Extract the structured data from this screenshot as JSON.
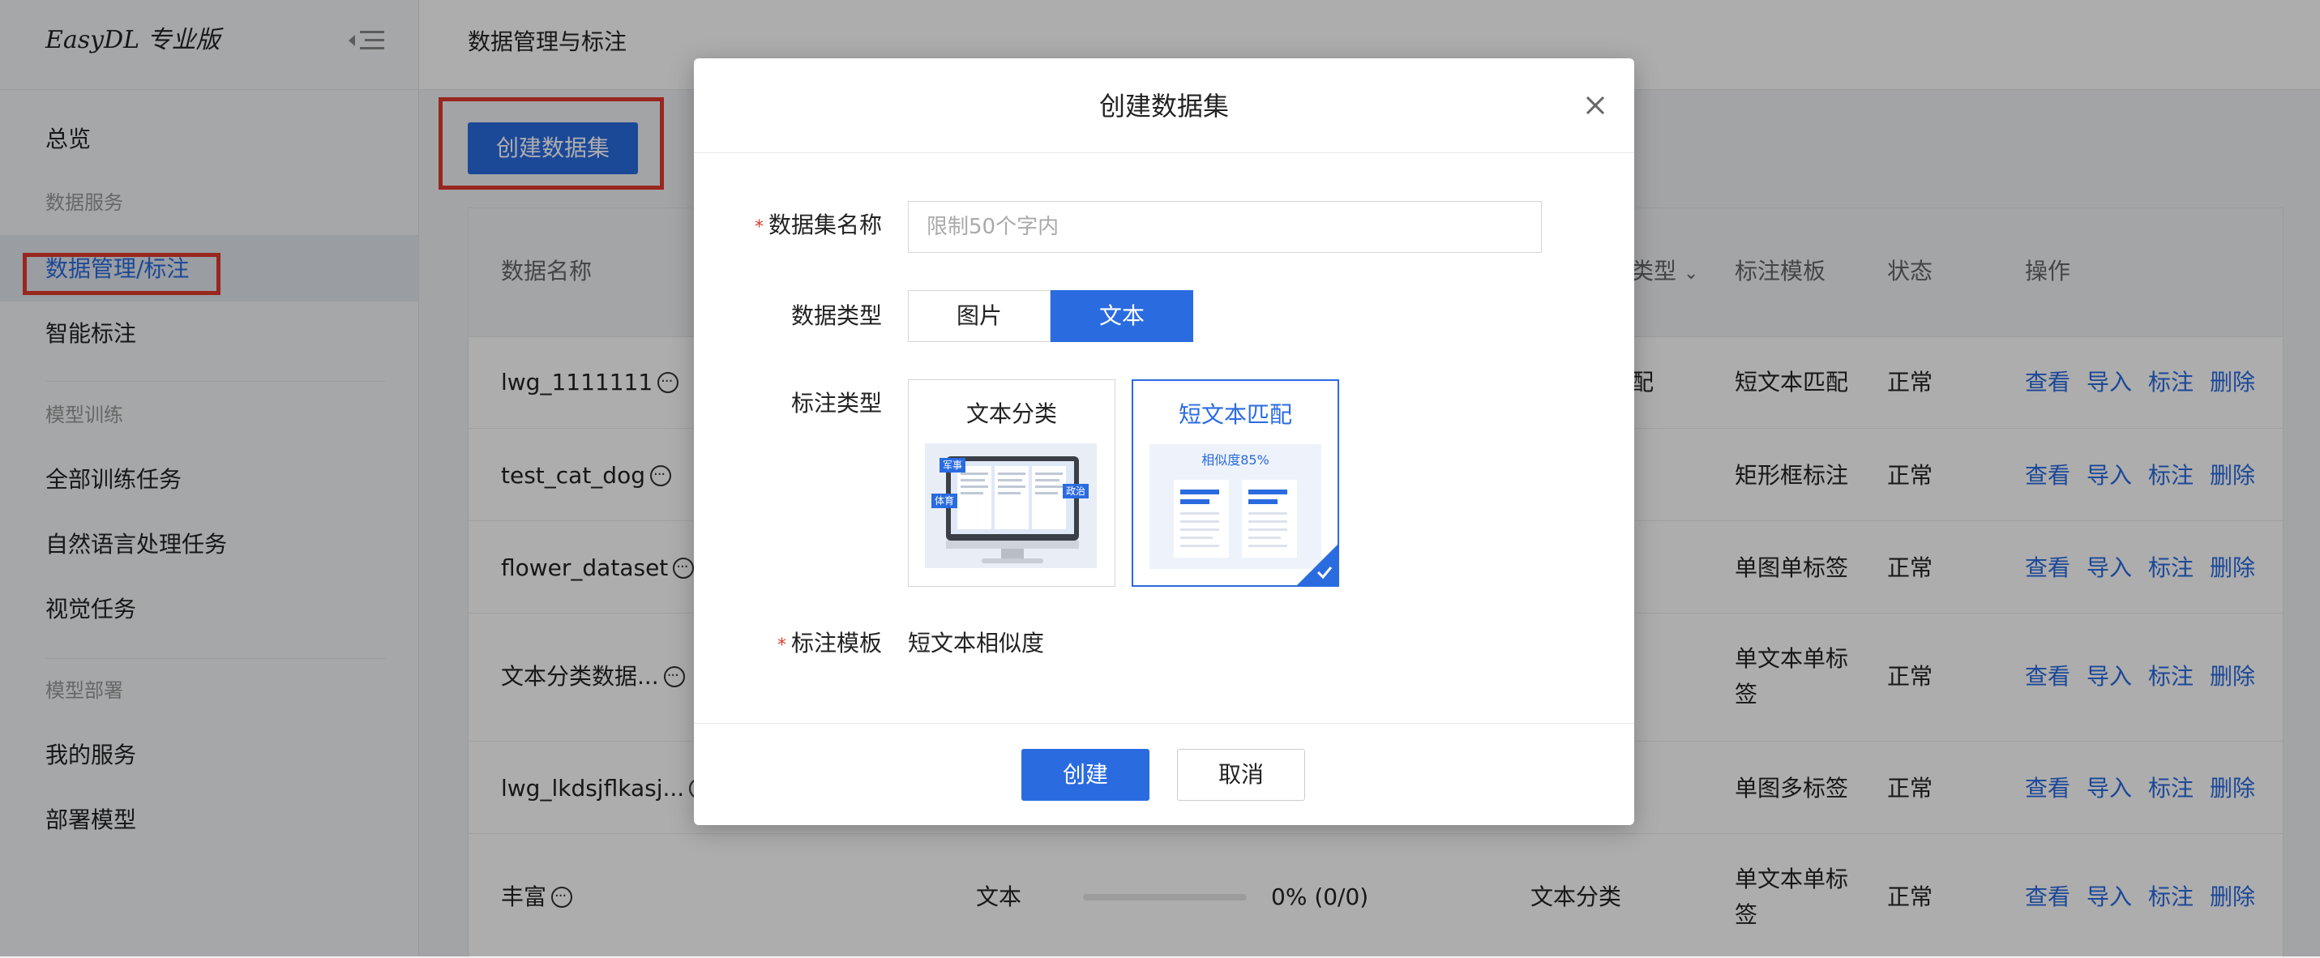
{
  "sidebar": {
    "brand": "EasyDL 专业版",
    "items": [
      {
        "label": "总览"
      },
      {
        "group": "数据服务"
      },
      {
        "label": "数据管理/标注",
        "active": true
      },
      {
        "label": "智能标注"
      },
      {
        "group": "模型训练"
      },
      {
        "label": "全部训练任务"
      },
      {
        "label": "自然语言处理任务"
      },
      {
        "label": "视觉任务"
      },
      {
        "group": "模型部署"
      },
      {
        "label": "我的服务"
      },
      {
        "label": "部署模型"
      }
    ]
  },
  "header": {
    "title": "数据管理与标注"
  },
  "toolbar": {
    "create_label": "创建数据集"
  },
  "table": {
    "columns": {
      "name": "数据名称",
      "type_partial": "类型",
      "template": "标注模板",
      "status": "状态",
      "ops": "操作"
    },
    "rows": [
      {
        "name": "lwg_1111111",
        "type_partial": "配",
        "template": "短文本匹配",
        "status": "正常"
      },
      {
        "name": "test_cat_dog",
        "template": "矩形框标注",
        "status": "正常"
      },
      {
        "name": "flower_dataset",
        "template": "单图单标签",
        "status": "正常"
      },
      {
        "name": "文本分类数据...",
        "template_line1": "单文本单标",
        "template_line2": "签",
        "status": "正常"
      },
      {
        "name": "lwg_lkdsjflkasj...",
        "template": "单图多标签",
        "status": "正常"
      },
      {
        "name": "丰富",
        "data_type": "文本",
        "progress_text": "0% (0/0)",
        "progress": 0,
        "label_type": "文本分类",
        "template_line1": "单文本单标",
        "template_line2": "签",
        "status": "正常"
      }
    ],
    "ops": {
      "view": "查看",
      "import": "导入",
      "label": "标注",
      "delete": "删除"
    }
  },
  "modal": {
    "title": "创建数据集",
    "name_label": "数据集名称",
    "name_placeholder": "限制50个字内",
    "name_value": "",
    "type_label": "数据类型",
    "type_options": [
      "图片",
      "文本"
    ],
    "type_selected": "文本",
    "label_type_label": "标注类型",
    "cards": [
      {
        "title": "文本分类",
        "tags": [
          "军事",
          "体育",
          "政治"
        ]
      },
      {
        "title": "短文本匹配",
        "caption": "相似度85%",
        "selected": true
      }
    ],
    "template_label": "标注模板",
    "template_value": "短文本相似度",
    "confirm_label": "创建",
    "cancel_label": "取消"
  },
  "colors": {
    "accent": "#2a6be0",
    "highlight": "#e03a2f"
  }
}
